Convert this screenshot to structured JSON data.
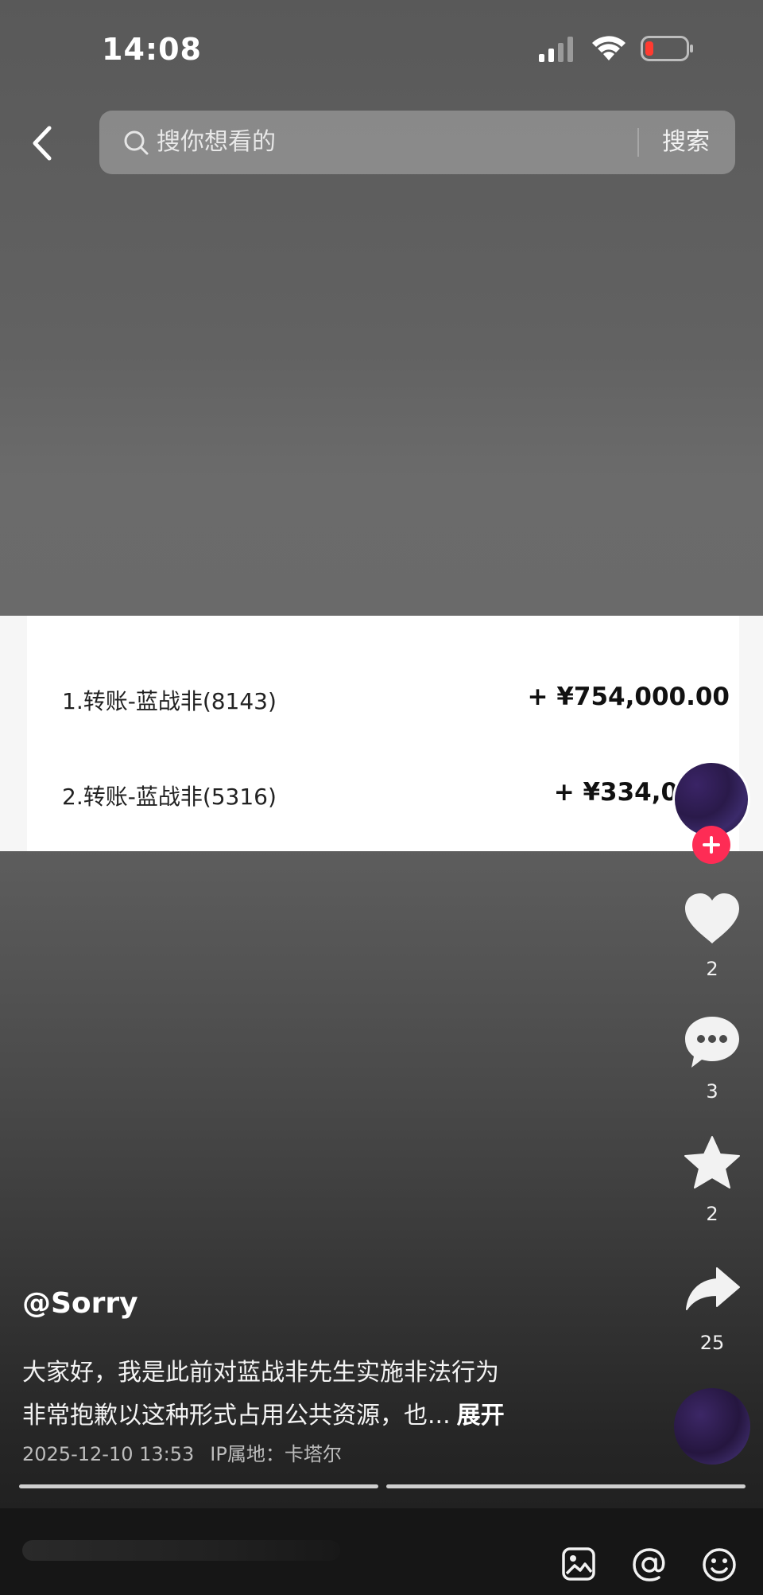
{
  "status_bar": {
    "time": "14:08"
  },
  "search": {
    "placeholder": "搜你想看的",
    "button_label": "搜索"
  },
  "transactions": [
    {
      "name": "1.转账-蓝战非(8143)",
      "amount": "+ ¥754,000.00"
    },
    {
      "name": "2.转账-蓝战非(5316)",
      "amount": "+ ¥334,000."
    }
  ],
  "actions": {
    "like_count": "2",
    "comment_count": "3",
    "favorite_count": "2",
    "share_count": "25"
  },
  "post": {
    "username": "@Sorry",
    "caption_line_1": "大家好，我是此前对蓝战非先生实施非法行为",
    "caption_line_2": "非常抱歉以这种形式占用公共资源，也...",
    "expand_label": "展开",
    "datetime": "2025-12-10 13:53",
    "ip_location": "IP属地：卡塔尔"
  },
  "colors": {
    "follow_accent": "#fe2c55",
    "battery_low": "#ff3b30"
  },
  "icons": {
    "back": "chevron-left-icon",
    "search": "search-icon",
    "follow": "plus-icon",
    "like": "heart-icon",
    "comment": "chat-bubble-icon",
    "favorite": "star-icon",
    "share": "share-arrow-icon",
    "image": "image-icon",
    "mention": "at-icon",
    "emoji": "emoji-icon"
  }
}
